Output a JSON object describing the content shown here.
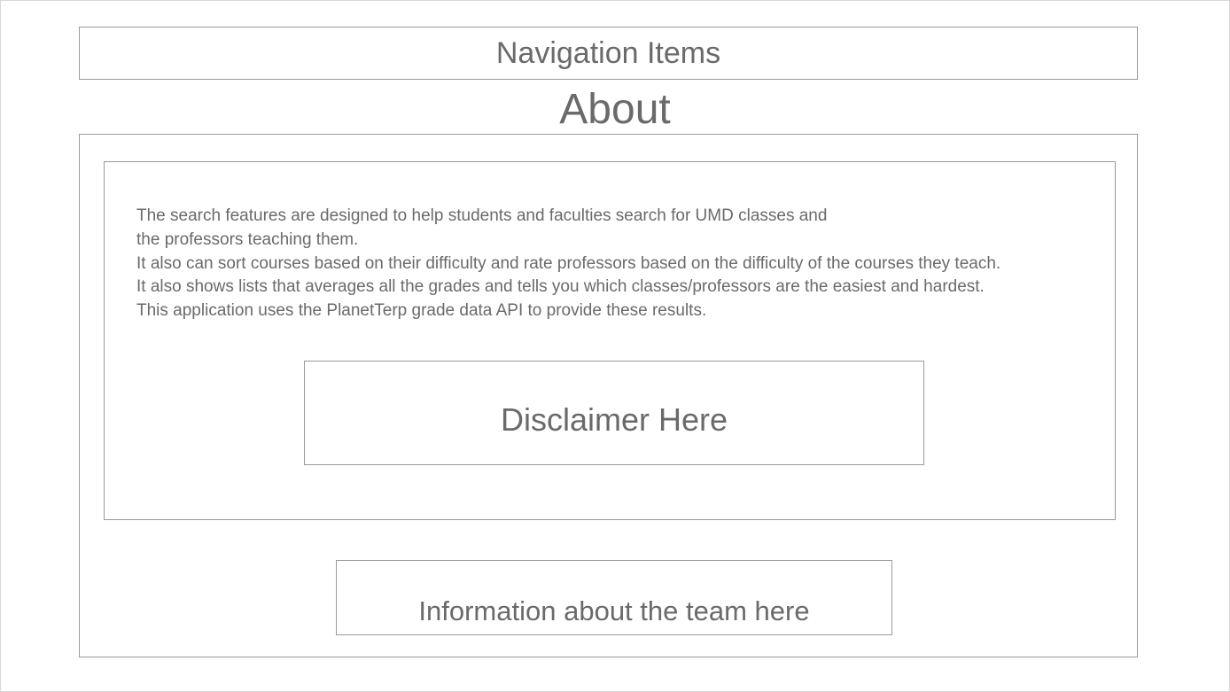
{
  "navigation": {
    "label": "Navigation Items"
  },
  "page": {
    "title": "About"
  },
  "about": {
    "lines": [
      "The search features are designed to help students and faculties search for UMD classes and",
      "the professors teaching them.",
      "It also can sort courses based on their difficulty and rate professors based on the difficulty of the courses they teach.",
      "It also shows lists that averages all the grades and tells you which classes/professors are the easiest and hardest.",
      "This application uses the PlanetTerp grade data API to provide these results."
    ]
  },
  "disclaimer": {
    "label": "Disclaimer Here"
  },
  "team": {
    "label": "Information about the team here"
  },
  "colors": {
    "text": "#6a6a6a",
    "border": "#9a9a9a",
    "background": "#ffffff"
  }
}
